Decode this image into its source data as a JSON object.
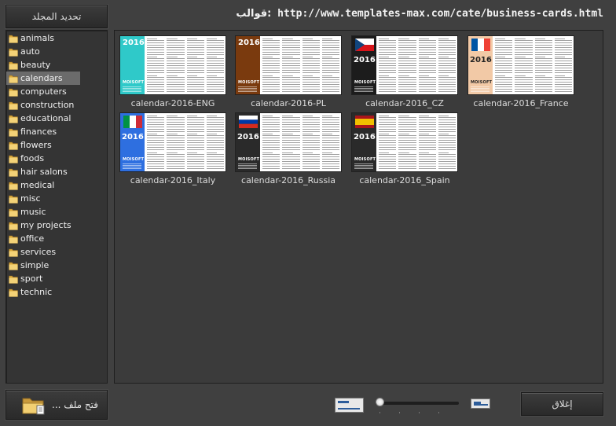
{
  "toolbar": {
    "update_folder_label": "تحديد المجلد",
    "close_label": "إغلاق",
    "open_file_label": "... فتح ملف"
  },
  "header": {
    "path_label": "قوالب:",
    "path_url": "http://www.templates-max.com/cate/business-cards.html"
  },
  "folders": [
    {
      "label": "animals",
      "selected": false
    },
    {
      "label": "auto",
      "selected": false
    },
    {
      "label": "beauty",
      "selected": false
    },
    {
      "label": "calendars",
      "selected": true
    },
    {
      "label": "computers",
      "selected": false
    },
    {
      "label": "construction",
      "selected": false
    },
    {
      "label": "educational",
      "selected": false
    },
    {
      "label": "finances",
      "selected": false
    },
    {
      "label": "flowers",
      "selected": false
    },
    {
      "label": "foods",
      "selected": false
    },
    {
      "label": "hair salons",
      "selected": false
    },
    {
      "label": "medical",
      "selected": false
    },
    {
      "label": "misc",
      "selected": false
    },
    {
      "label": "music",
      "selected": false
    },
    {
      "label": "my projects",
      "selected": false
    },
    {
      "label": "office",
      "selected": false
    },
    {
      "label": "services",
      "selected": false
    },
    {
      "label": "simple",
      "selected": false
    },
    {
      "label": "sport",
      "selected": false
    },
    {
      "label": "technic",
      "selected": false
    }
  ],
  "templates": [
    {
      "label": "calendar-2016-ENG",
      "style": "teal",
      "strip_color": "#2fc9c9",
      "year": "2016",
      "brand": "MOISOFT"
    },
    {
      "label": "calendar-2016-PL",
      "style": "brown",
      "strip_color": "#7a3a0e",
      "year": "2016",
      "brand": "MOISOFT"
    },
    {
      "label": "calendar-2016_CZ",
      "style": "flag",
      "flag": "cz",
      "strip_color": "#1c1c1c",
      "year": "2016",
      "brand": "MOISOFT"
    },
    {
      "label": "calendar-2016_France",
      "style": "flag",
      "flag": "fr",
      "strip_color": "#f2c9a6",
      "year": "2016",
      "brand": "MOISOFT"
    },
    {
      "label": "calendar-2016_Italy",
      "style": "flag",
      "flag": "it",
      "strip_color": "#2e6fe0",
      "year": "2016",
      "brand": "MOISOFT"
    },
    {
      "label": "calendar-2016_Russia",
      "style": "flag",
      "flag": "ru",
      "strip_color": "#2a2a2a",
      "year": "2016",
      "brand": "MOISOFT"
    },
    {
      "label": "calendar-2016_Spain",
      "style": "flag",
      "flag": "es",
      "strip_color": "#2a2a2a",
      "year": "2016",
      "brand": "MOISOFT"
    }
  ],
  "zoom": {
    "level": 0
  },
  "colors": {
    "background": "#404040",
    "panel": "#343434",
    "selected": "#6b6b6b"
  }
}
